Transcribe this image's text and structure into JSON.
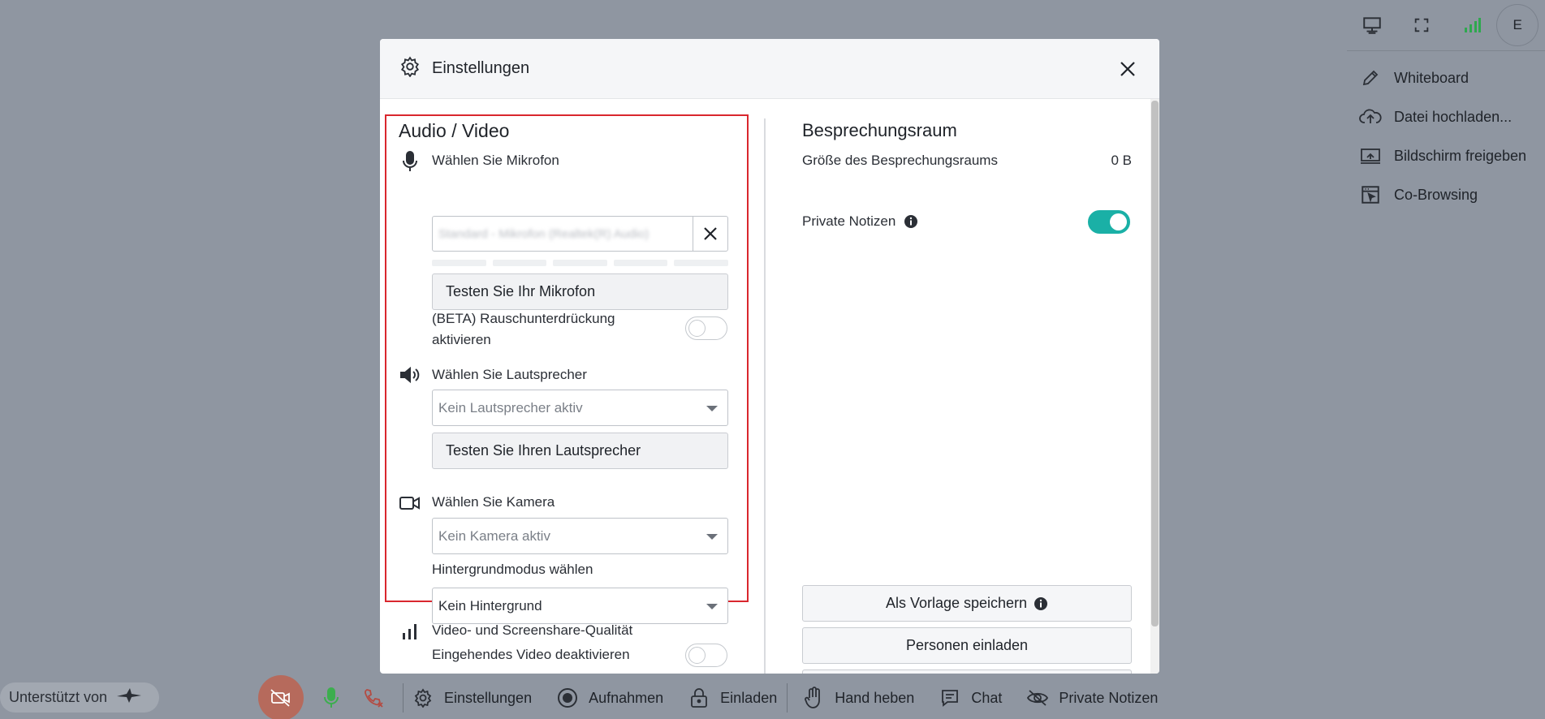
{
  "top_right": {
    "avatar_initial": "E"
  },
  "side_menu": [
    {
      "label": "Whiteboard",
      "icon": "pencil-icon"
    },
    {
      "label": "Datei hochladen...",
      "icon": "cloud-upload-icon"
    },
    {
      "label": "Bildschirm freigeben",
      "icon": "screen-share-icon"
    },
    {
      "label": "Co-Browsing",
      "icon": "co-browsing-icon"
    }
  ],
  "bottom": {
    "powered_by": "Unterstützt von",
    "items": [
      {
        "label": "Einstellungen",
        "icon": "gear-icon"
      },
      {
        "label": "Aufnahmen",
        "icon": "record-icon"
      },
      {
        "label": "Einladen",
        "icon": "lock-icon"
      },
      {
        "label": "Hand heben",
        "icon": "hand-icon"
      },
      {
        "label": "Chat",
        "icon": "chat-icon"
      },
      {
        "label": "Private Notizen",
        "icon": "eye-off-icon"
      }
    ]
  },
  "modal": {
    "title": "Einstellungen",
    "audio_video": {
      "title": "Audio / Video",
      "microphone_label": "Wählen Sie Mikrofon",
      "microphone_value": "Standard - Mikrofon (Realtek(R) Audio)",
      "test_microphone": "Testen Sie Ihr Mikrofon",
      "noise_suppression_label_1": "(BETA) Rauschunterdrückung",
      "noise_suppression_label_2": "aktivieren",
      "speaker_label": "Wählen Sie Lautsprecher",
      "speaker_value": "Kein Lautsprecher aktiv",
      "test_speaker": "Testen Sie Ihren Lautsprecher",
      "camera_label": "Wählen Sie Kamera",
      "camera_value": "Kein Kamera aktiv",
      "background_label": "Hintergrundmodus wählen",
      "background_value": "Kein Hintergrund",
      "quality_label": "Video- und Screenshare-Qualität",
      "incoming_video_label": "Eingehendes Video deaktivieren"
    },
    "meeting_room": {
      "title": "Besprechungsraum",
      "size_label": "Größe des Besprechungsraums",
      "size_value": "0 B",
      "private_notes_label": "Private Notizen",
      "private_notes_enabled": true,
      "save_template": "Als Vorlage speichern",
      "invite_people": "Personen einladen"
    }
  },
  "colors": {
    "accent_teal": "#1ab0a6",
    "highlight_red": "#d9272e",
    "mic_green": "#3cae4e",
    "camera_off": "#b66a5c"
  }
}
